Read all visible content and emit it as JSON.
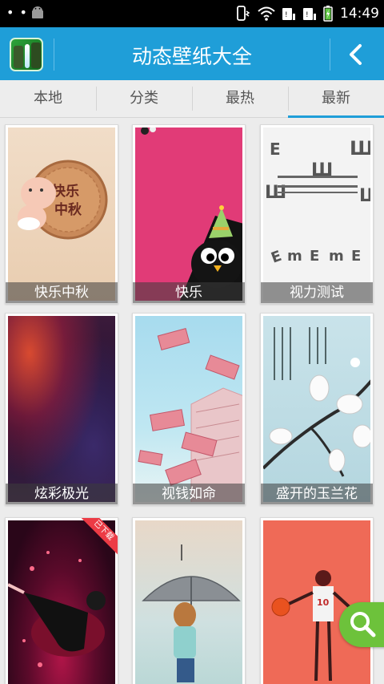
{
  "status_bar": {
    "time": "14:49",
    "dots": "• • •"
  },
  "header": {
    "title": "动态壁纸大全",
    "accent_color": "#1f9ed8"
  },
  "tabs": [
    {
      "label": "本地",
      "active": false
    },
    {
      "label": "分类",
      "active": false
    },
    {
      "label": "最热",
      "active": false
    },
    {
      "label": "最新",
      "active": true
    }
  ],
  "wallpapers": [
    {
      "title": "快乐中秋",
      "art": "mid-autumn-mooncake-baby"
    },
    {
      "title": "快乐",
      "art": "penguin-party-hat"
    },
    {
      "title": "视力测试",
      "art": "eye-chart"
    },
    {
      "title": "炫彩极光",
      "art": "aurora"
    },
    {
      "title": "视钱如命",
      "art": "flying-banknotes"
    },
    {
      "title": "盛开的玉兰花",
      "art": "magnolia-flowers"
    },
    {
      "title": "",
      "art": "dancer",
      "badge": "已下载"
    },
    {
      "title": "",
      "art": "girl-umbrella"
    },
    {
      "title": "",
      "art": "basketball-player"
    }
  ],
  "mooncake_text": "快乐中秋",
  "eye_chart_letters": "E E E E"
}
